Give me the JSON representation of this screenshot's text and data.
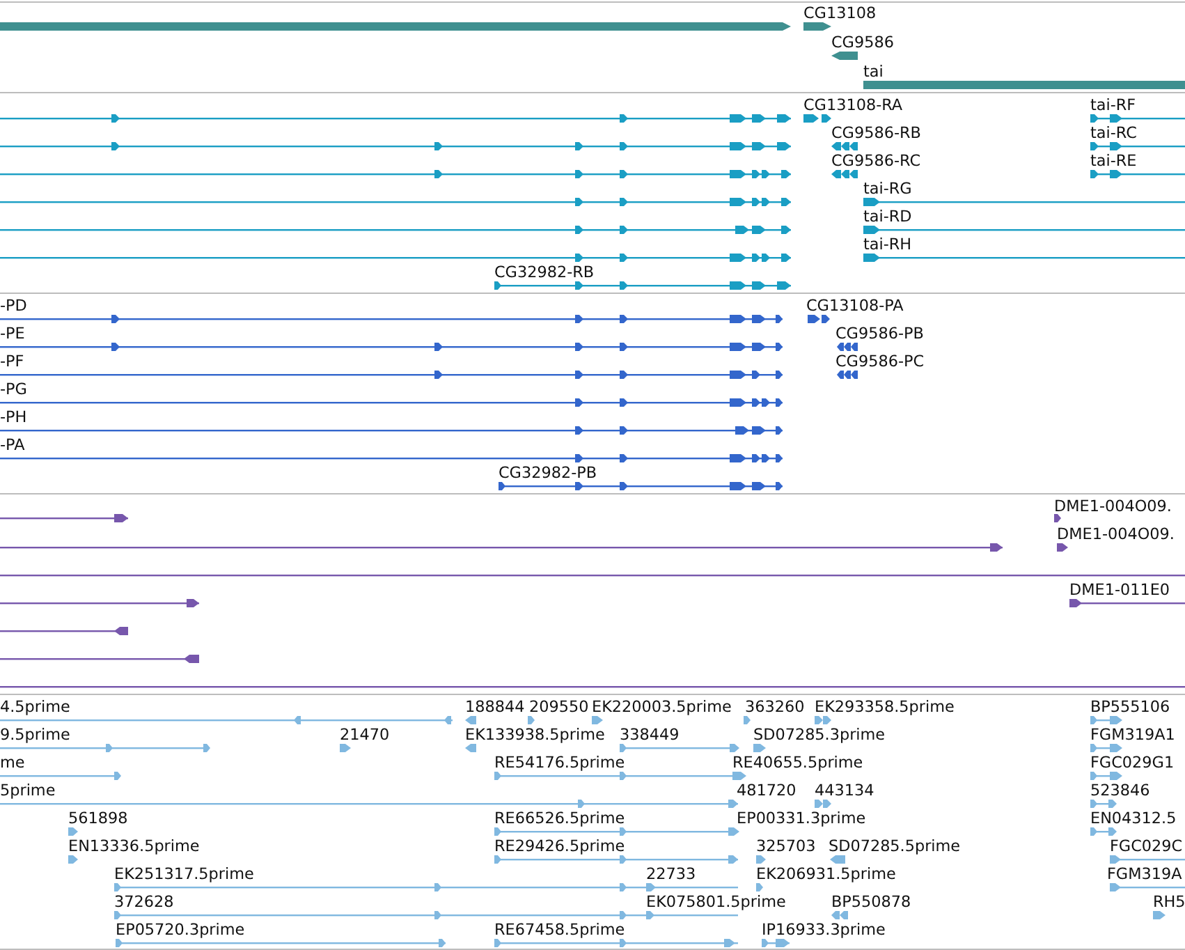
{
  "tracks": [
    {
      "kind": "gene",
      "features": [
        {
          "label": "CG13108"
        },
        {
          "label": "CG9586"
        },
        {
          "label": "tai"
        }
      ]
    },
    {
      "kind": "transcript",
      "features": [
        {
          "label": "CG13108-RA"
        },
        {
          "label": "tai-RF"
        },
        {
          "label": "CG9586-RB"
        },
        {
          "label": "tai-RC"
        },
        {
          "label": "CG9586-RC"
        },
        {
          "label": "tai-RE"
        },
        {
          "label": "tai-RG"
        },
        {
          "label": "tai-RD"
        },
        {
          "label": "tai-RH"
        },
        {
          "label": "CG32982-RB"
        }
      ]
    },
    {
      "kind": "protein",
      "features": [
        {
          "label": "-PD"
        },
        {
          "label": "CG13108-PA"
        },
        {
          "label": "-PE"
        },
        {
          "label": "CG9586-PB"
        },
        {
          "label": "-PF"
        },
        {
          "label": "CG9586-PC"
        },
        {
          "label": "-PG"
        },
        {
          "label": "-PH"
        },
        {
          "label": "-PA"
        },
        {
          "label": "CG32982-PB"
        }
      ]
    },
    {
      "kind": "clone",
      "features": [
        {
          "label": "DME1-004O09."
        },
        {
          "label": "DME1-004O09."
        },
        {
          "label": "DME1-011E0"
        }
      ]
    },
    {
      "kind": "est",
      "features": [
        {
          "label": "4.5prime"
        },
        {
          "label": "188844"
        },
        {
          "label": "209550"
        },
        {
          "label": "EK220003.5prime"
        },
        {
          "label": "363260"
        },
        {
          "label": "EK293358.5prime"
        },
        {
          "label": "BP555106"
        },
        {
          "label": "9.5prime"
        },
        {
          "label": "21470"
        },
        {
          "label": "EK133938.5prime"
        },
        {
          "label": "338449"
        },
        {
          "label": "SD07285.3prime"
        },
        {
          "label": "FGM319A1"
        },
        {
          "label": "me"
        },
        {
          "label": "RE54176.5prime"
        },
        {
          "label": "RE40655.5prime"
        },
        {
          "label": "FGC029G1"
        },
        {
          "label": "5prime"
        },
        {
          "label": "481720"
        },
        {
          "label": "443134"
        },
        {
          "label": "523846"
        },
        {
          "label": "561898"
        },
        {
          "label": "RE66526.5prime"
        },
        {
          "label": "EP00331.3prime"
        },
        {
          "label": "EN04312.5"
        },
        {
          "label": "EN13336.5prime"
        },
        {
          "label": "RE29426.5prime"
        },
        {
          "label": "325703"
        },
        {
          "label": "SD07285.5prime"
        },
        {
          "label": "FGC029C"
        },
        {
          "label": "EK251317.5prime"
        },
        {
          "label": "22733"
        },
        {
          "label": "EK206931.5prime"
        },
        {
          "label": "FGM319A"
        },
        {
          "label": "372628"
        },
        {
          "label": "EK075801.5prime"
        },
        {
          "label": "BP550878"
        },
        {
          "label": "RH5"
        },
        {
          "label": "EP05720.3prime"
        },
        {
          "label": "RE67458.5prime"
        },
        {
          "label": "IP16933.3prime"
        }
      ]
    }
  ]
}
